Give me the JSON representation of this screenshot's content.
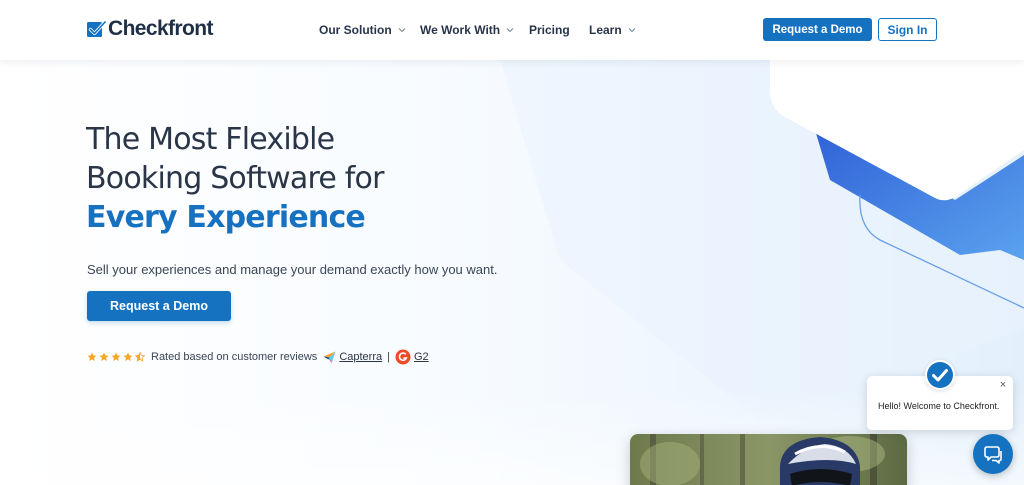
{
  "header": {
    "logo_text": "Checkfront",
    "nav": [
      {
        "label": "Our Solution",
        "has_dropdown": true
      },
      {
        "label": "We Work With",
        "has_dropdown": true
      },
      {
        "label": "Pricing",
        "has_dropdown": false
      },
      {
        "label": "Learn",
        "has_dropdown": true
      }
    ],
    "request_demo_label": "Request a Demo",
    "sign_in_label": "Sign In"
  },
  "hero": {
    "headline_line1": "The Most Flexible",
    "headline_line2": "Booking Software for",
    "headline_accent": "Every Experience",
    "subtext": "Sell your experiences and manage your demand exactly how you want.",
    "cta_label": "Request a Demo",
    "rating": {
      "stars": 4.5,
      "text": "Rated based on customer reviews",
      "capterra_label": "Capterra",
      "separator": "|",
      "g2_label": "G2"
    }
  },
  "chat": {
    "message": "Hello! Welcome to Checkfront.",
    "close_glyph": "×"
  },
  "colors": {
    "brand_blue": "#1572c1",
    "heading": "#2a3547",
    "star": "#f5a623",
    "g2_red": "#ef4a26"
  },
  "icons": {
    "logo": "checkbox-check-icon",
    "nav_dropdown": "chevron-down-icon",
    "star": "star-icon",
    "capterra": "capterra-arrow-icon",
    "g2": "g2-logo-icon",
    "chat_avatar": "check-circle-icon",
    "chat_close": "close-icon",
    "chat_launcher": "chat-bubbles-icon"
  }
}
